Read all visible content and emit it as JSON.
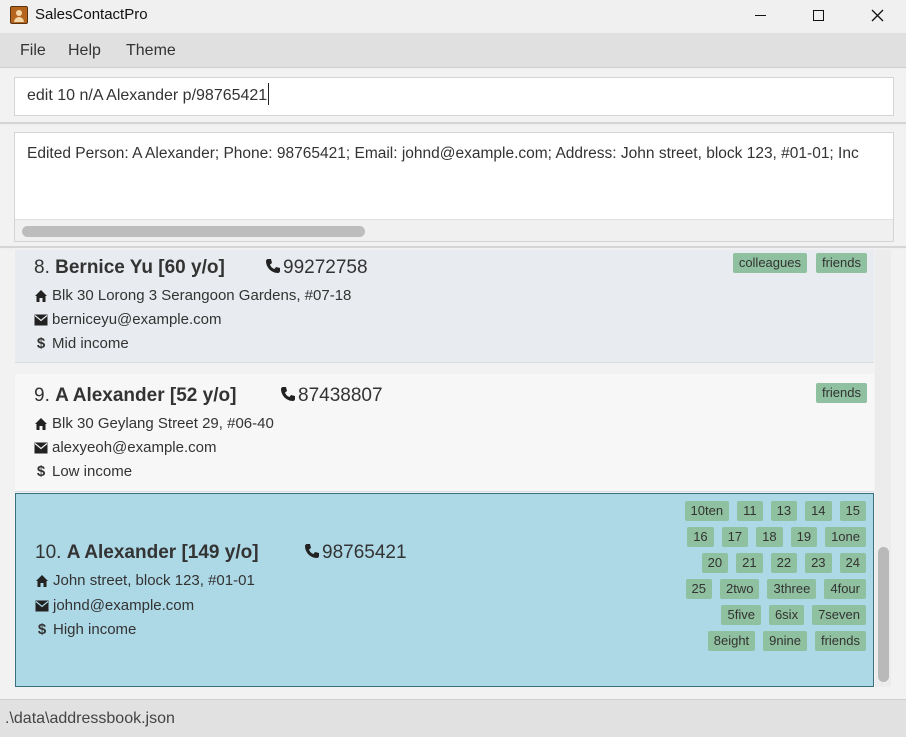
{
  "window": {
    "title": "SalesContactPro",
    "icon": "address-book-icon",
    "controls": {
      "minimize": "minimize",
      "maximize": "maximize",
      "close": "close"
    }
  },
  "menu": {
    "items": [
      "File",
      "Help",
      "Theme"
    ]
  },
  "command": {
    "value": "edit 10 n/A Alexander p/98765421"
  },
  "result": {
    "text": "Edited Person: A Alexander; Phone: 98765421; Email: johnd@example.com; Address: John street, block 123, #01-01; Inc"
  },
  "persons": [
    {
      "index": "8.",
      "name": "Bernice Yu [60 y/o]",
      "phone": "99272758",
      "address": "Blk 30 Lorong 3 Serangoon Gardens, #07-18",
      "email": "berniceyu@example.com",
      "income": "Mid income",
      "tags": [
        "colleagues",
        "friends"
      ]
    },
    {
      "index": "9.",
      "name": "A Alexander [52 y/o]",
      "phone": "87438807",
      "address": "Blk 30 Geylang Street 29, #06-40",
      "email": "alexyeoh@example.com",
      "income": "Low income",
      "tags": [
        "friends"
      ]
    },
    {
      "index": "10.",
      "name": "A Alexander [149 y/o]",
      "phone": "98765421",
      "address": "John street, block 123, #01-01",
      "email": "johnd@example.com",
      "income": "High income",
      "selected": true,
      "tags": [
        "10ten",
        "11",
        "13",
        "14",
        "15",
        "16",
        "17",
        "18",
        "19",
        "1one",
        "20",
        "21",
        "22",
        "23",
        "24",
        "25",
        "2two",
        "3three",
        "4four",
        "5five",
        "6six",
        "7seven",
        "8eight",
        "9nine",
        "friends"
      ]
    }
  ],
  "status": {
    "path": ".\\data\\addressbook.json"
  },
  "colors": {
    "tag": "#8fc0a0",
    "selected_card": "#add8e6"
  }
}
